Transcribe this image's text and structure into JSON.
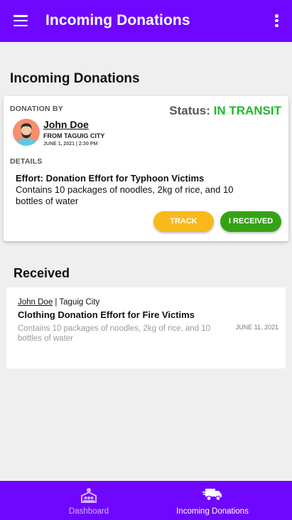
{
  "appbar": {
    "title": "Incoming Donations"
  },
  "page": {
    "section_title": "Incoming Donations"
  },
  "donation_card": {
    "donation_by_label": "DONATION BY",
    "status_label": "Status:",
    "status_value": "IN TRANSIT",
    "status_color": "#1fba2b",
    "donor_name": "John Doe",
    "donor_from": "FROM TAGUIG CITY",
    "date": "JUNE 1, 2021 | 2:30 PM",
    "details_label": "DETAILS",
    "effort": "Effort: Donation Effort for Typhoon Victims",
    "description": "Contains 10 packages of noodles, 2kg of rice, and 10 bottles of water",
    "track_button": "TRACK",
    "received_button": "I RECEIVED"
  },
  "received": {
    "title": "Received",
    "items": [
      {
        "name": "John Doe",
        "separator": " | ",
        "city": "Taguig City",
        "title": "Clothing Donation Effort for Fire Victims",
        "description": "Contains 10 packages of noodles, 2kg of rice, and 10 bottles of water",
        "date": "JUNE 11, 2021"
      }
    ]
  },
  "bottom_nav": {
    "items": [
      {
        "label": "Dashboard",
        "icon": "dashboard-icon",
        "active": false
      },
      {
        "label": "Incoming Donations",
        "icon": "truck-icon",
        "active": true
      }
    ]
  },
  "colors": {
    "primary": "#6f07ff",
    "track": "#f9b81b",
    "received": "#33a315"
  }
}
